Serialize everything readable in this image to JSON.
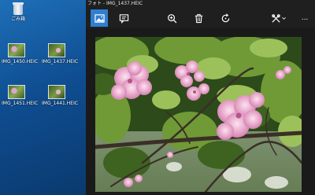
{
  "desktop": {
    "recycle_bin": {
      "label": "ごみ箱",
      "icon": "recycle-bin-icon"
    },
    "files": [
      {
        "label": "IMG_1450.HEIC",
        "icon": "image-file-icon"
      },
      {
        "label": "IMG_1437.HEIC",
        "icon": "image-file-icon"
      },
      {
        "label": "IMG_1451.HEIC",
        "icon": "image-file-icon"
      },
      {
        "label": "IMG_1441.HEIC",
        "icon": "image-file-icon"
      }
    ]
  },
  "window": {
    "app_name": "フォト",
    "separator": " - ",
    "file_name": "IMG_1437.HEIC",
    "colors": {
      "background": "#1f1f1f",
      "accent": "#2f7fd0"
    },
    "toolbar": [
      {
        "id": "photo",
        "icon": "photo-view-icon",
        "selected": true
      },
      {
        "id": "info",
        "icon": "info-icon",
        "selected": false
      },
      {
        "id": "zoom",
        "icon": "zoom-icon",
        "selected": false
      },
      {
        "id": "delete",
        "icon": "trash-icon",
        "selected": false
      },
      {
        "id": "rotate",
        "icon": "rotate-icon",
        "selected": false
      },
      {
        "id": "edit",
        "icon": "edit-icon",
        "selected": false
      },
      {
        "id": "more",
        "icon": "more-icon",
        "label": "...",
        "selected": false
      }
    ]
  }
}
